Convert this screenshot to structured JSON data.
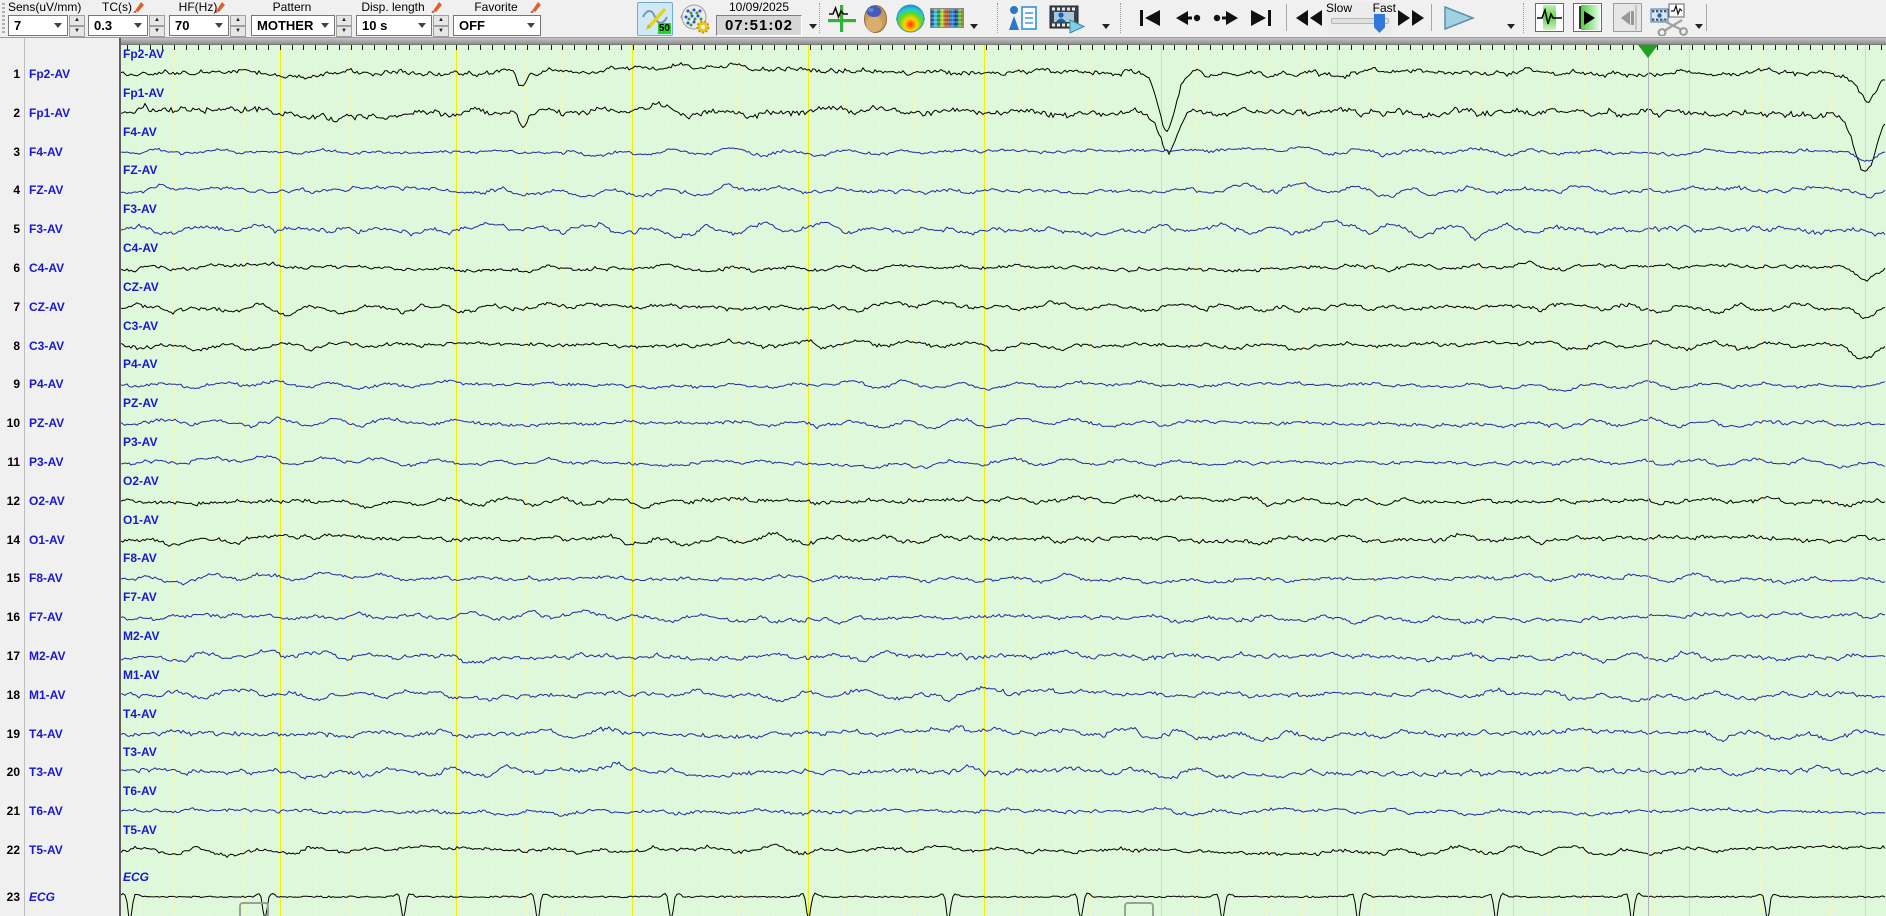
{
  "toolbar": {
    "groups": [
      {
        "label": "Sens(uV/mm)",
        "value": "7"
      },
      {
        "label": "TC(s)",
        "value": "0.3"
      },
      {
        "label": "HF(Hz)",
        "value": "70"
      },
      {
        "label": "Pattern",
        "value": "MOTHER"
      },
      {
        "label": "Disp. length",
        "value": "10 s"
      },
      {
        "label": "Favorite",
        "value": "OFF"
      }
    ],
    "notch_badge": "50",
    "date": "10/09/2025",
    "time": "07:51:02",
    "slider": {
      "left_label": "Slow",
      "right_label": "Fast"
    }
  },
  "icons": {
    "notch-filter-icon": "sine-wave-lightning-50",
    "montage-setup-icon": "head-electrodes-gear",
    "event-marker-icon": "green-crosshair-wave",
    "head-3d-icon": "3d-head",
    "topo-map-icon": "rainbow-topography-head",
    "spectrogram-icon": "color-spectrogram",
    "patient-info-icon": "person-with-list",
    "video-icon": "film-person-play",
    "clip-icon": "film-scissors"
  },
  "colors": {
    "trace_black": "#000000",
    "trace_blue": "#1c2fa0",
    "label_blue": "#1818cf",
    "background_green": "#dff7da",
    "grid_major": "#f0f000",
    "grid_minor": "#ffffa0",
    "marker_green": "#1ea11e"
  },
  "channels": [
    {
      "num": "1",
      "label": "Fp2-AV",
      "color": "#000000"
    },
    {
      "num": "2",
      "label": "Fp1-AV",
      "color": "#000000"
    },
    {
      "num": "3",
      "label": "F4-AV",
      "color": "#1c2fa0"
    },
    {
      "num": "4",
      "label": "FZ-AV",
      "color": "#1c2fa0"
    },
    {
      "num": "5",
      "label": "F3-AV",
      "color": "#1c2fa0"
    },
    {
      "num": "6",
      "label": "C4-AV",
      "color": "#000000"
    },
    {
      "num": "7",
      "label": "CZ-AV",
      "color": "#000000"
    },
    {
      "num": "8",
      "label": "C3-AV",
      "color": "#000000"
    },
    {
      "num": "9",
      "label": "P4-AV",
      "color": "#1c2fa0"
    },
    {
      "num": "10",
      "label": "PZ-AV",
      "color": "#1c2fa0"
    },
    {
      "num": "11",
      "label": "P3-AV",
      "color": "#1c2fa0"
    },
    {
      "num": "12",
      "label": "O2-AV",
      "color": "#000000"
    },
    {
      "num": "14",
      "label": "O1-AV",
      "color": "#000000"
    },
    {
      "num": "15",
      "label": "F8-AV",
      "color": "#1c2fa0"
    },
    {
      "num": "16",
      "label": "F7-AV",
      "color": "#1c2fa0"
    },
    {
      "num": "17",
      "label": "M2-AV",
      "color": "#1c2fa0"
    },
    {
      "num": "18",
      "label": "M1-AV",
      "color": "#1c2fa0"
    },
    {
      "num": "19",
      "label": "T4-AV",
      "color": "#1c2fa0"
    },
    {
      "num": "20",
      "label": "T3-AV",
      "color": "#1c2fa0"
    },
    {
      "num": "21",
      "label": "T6-AV",
      "color": "#1c2fa0"
    },
    {
      "num": "22",
      "label": "T5-AV",
      "color": "#000000",
      "italic": false
    },
    {
      "num": "23",
      "label": "ECG",
      "color": "#000000",
      "italic": true,
      "type": "ecg"
    }
  ]
}
